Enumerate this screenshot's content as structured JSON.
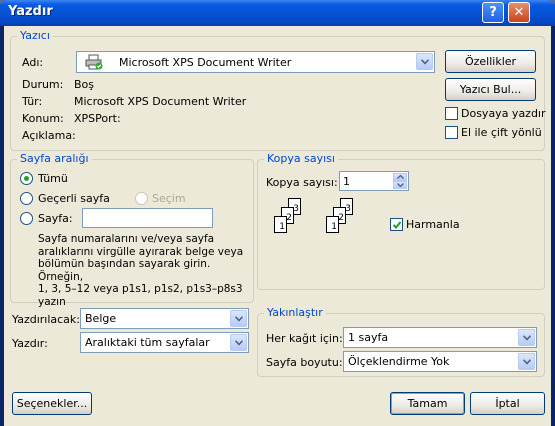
{
  "window": {
    "title": "Yazdır",
    "help_glyph": "?",
    "close_glyph": "✕"
  },
  "printer": {
    "legend": "Yazıcı",
    "name_label": "Adı:",
    "name_value": "Microsoft XPS Document Writer",
    "status_label": "Durum:",
    "status_value": "Boş",
    "type_label": "Tür:",
    "type_value": "Microsoft XPS Document Writer",
    "location_label": "Konum:",
    "location_value": "XPSPort:",
    "comment_label": "Açıklama:",
    "properties_button": "Özellikler",
    "find_printer_button": "Yazıcı Bul...",
    "print_to_file_label": "Dosyaya yazdır",
    "print_to_file_checked": false,
    "manual_duplex_label": "El ile çift yönlü",
    "manual_duplex_checked": false
  },
  "page_range": {
    "legend": "Sayfa aralığı",
    "all_label": "Tümü",
    "current_page_label": "Geçerli sayfa",
    "selection_label": "Seçim",
    "pages_label": "Sayfa:",
    "pages_value": "",
    "selected": "all",
    "help_lines": [
      "Sayfa numaralarını ve/veya sayfa",
      "aralıklarını virgülle ayırarak belge veya",
      "bölümün başından sayarak girin. Örneğin,",
      "1, 3, 5–12 veya p1s1, p1s2, p1s3–p8s3",
      "yazın"
    ]
  },
  "copies": {
    "legend": "Kopya sayısı",
    "count_label": "Kopya sayısı:",
    "count_value": "1",
    "collate_label": "Harmanla",
    "collate_checked": true,
    "page_numbers": [
      "3",
      "2",
      "1"
    ]
  },
  "print_what": {
    "label": "Yazdırılacak:",
    "value": "Belge"
  },
  "print": {
    "label": "Yazdır:",
    "value": "Aralıktaki tüm sayfalar"
  },
  "zoom": {
    "legend": "Yakınlaştır",
    "pages_per_sheet_label": "Her kağıt için:",
    "pages_per_sheet_value": "1 sayfa",
    "scale_label": "Sayfa boyutu:",
    "scale_value": "Ölçeklendirme Yok"
  },
  "footer": {
    "options_button": "Seçenekler...",
    "ok_button": "Tamam",
    "cancel_button": "İptal"
  }
}
